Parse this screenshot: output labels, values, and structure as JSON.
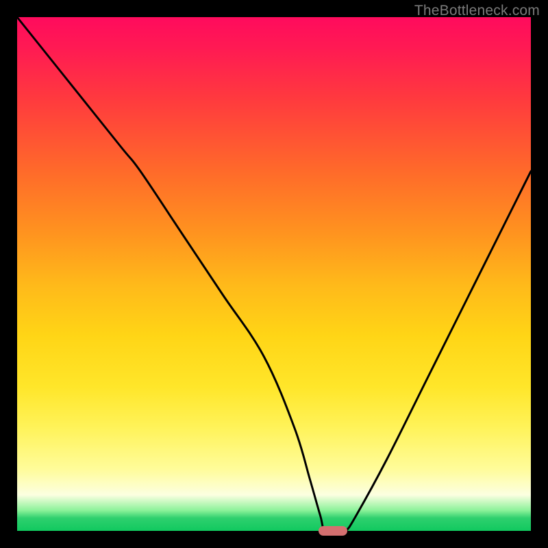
{
  "watermark": "TheBottleneck.com",
  "colors": {
    "background": "#000000",
    "curve": "#000000",
    "marker": "#d47070"
  },
  "chart_data": {
    "type": "line",
    "title": "",
    "xlabel": "",
    "ylabel": "",
    "xlim": [
      0,
      100
    ],
    "ylim": [
      0,
      100
    ],
    "grid": false,
    "series": [
      {
        "name": "bottleneck-curve",
        "x": [
          0,
          8,
          20,
          24,
          32,
          40,
          48,
          54,
          57,
          59,
          60,
          63,
          64,
          66,
          72,
          80,
          88,
          96,
          100
        ],
        "values": [
          100,
          90,
          75,
          70,
          58,
          46,
          34,
          20,
          10,
          3,
          0,
          0,
          0,
          3,
          14,
          30,
          46,
          62,
          70
        ]
      }
    ],
    "marker": {
      "x": 61.5,
      "y": 0,
      "width_pct": 5.6
    },
    "background_gradient": {
      "orientation": "vertical",
      "stops": [
        {
          "pct": 0,
          "color": "#ff0b5d"
        },
        {
          "pct": 16,
          "color": "#ff3a3e"
        },
        {
          "pct": 42,
          "color": "#ff931f"
        },
        {
          "pct": 72,
          "color": "#ffe62a"
        },
        {
          "pct": 93,
          "color": "#fcffe1"
        },
        {
          "pct": 100,
          "color": "#11c95f"
        }
      ]
    }
  }
}
